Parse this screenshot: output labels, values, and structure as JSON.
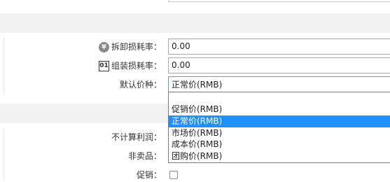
{
  "form": {
    "disassembly_loss_rate": {
      "label": "拆卸损耗率：",
      "value": "0.00",
      "icon": "yen-icon",
      "icon_glyph": "¥"
    },
    "assembly_loss_rate": {
      "label": "组装损耗率：",
      "value": "0.00",
      "icon": "01-icon",
      "icon_glyph": "01"
    },
    "default_price_type": {
      "label": "默认价种：",
      "selected": "正常价(RMB)",
      "options": [
        "",
        "促销价(RMB)",
        "正常价(RMB)",
        "市场价(RMB)",
        "成本价(RMB)",
        "团购价(RMB)"
      ]
    },
    "no_profit": {
      "label": "不计算利润："
    },
    "non_sale_item": {
      "label": "非卖品："
    },
    "promotion": {
      "label": "促销："
    }
  },
  "colors": {
    "highlight": "#1e90ff",
    "focus_border": "#5b9bd5",
    "band": "#f2f2f2"
  }
}
